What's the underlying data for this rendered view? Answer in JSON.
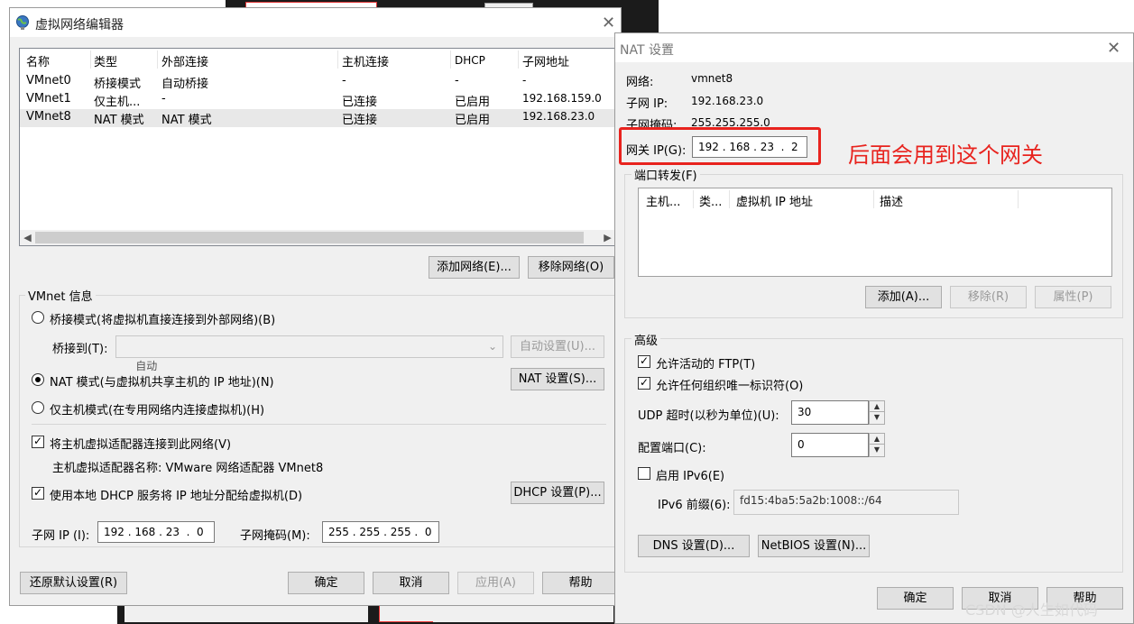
{
  "vne": {
    "title": "虚拟网络编辑器",
    "columns": [
      "名称",
      "类型",
      "外部连接",
      "主机连接",
      "DHCP",
      "子网地址"
    ],
    "rows": [
      {
        "name": "VMnet0",
        "type": "桥接模式",
        "ext": "自动桥接",
        "host": "-",
        "dhcp": "-",
        "subnet": "-"
      },
      {
        "name": "VMnet1",
        "type": "仅主机...",
        "ext": "-",
        "host": "已连接",
        "dhcp": "已启用",
        "subnet": "192.168.159.0"
      },
      {
        "name": "VMnet8",
        "type": "NAT 模式",
        "ext": "NAT 模式",
        "host": "已连接",
        "dhcp": "已启用",
        "subnet": "192.168.23.0"
      }
    ],
    "add_network": "添加网络(E)...",
    "remove_network": "移除网络(O)",
    "vmnet_info": "VMnet 信息",
    "bridge_mode": "桥接模式(将虚拟机直接连接到外部网络)(B)",
    "bridge_to": "桥接到(T):",
    "bridge_value": "自动",
    "auto_settings": "自动设置(U)...",
    "nat_mode": "NAT 模式(与虚拟机共享主机的 IP 地址)(N)",
    "nat_settings": "NAT 设置(S)...",
    "host_only": "仅主机模式(在专用网络内连接虚拟机)(H)",
    "connect_adapter": "将主机虚拟适配器连接到此网络(V)",
    "adapter_name": "主机虚拟适配器名称: VMware 网络适配器 VMnet8",
    "use_dhcp": "使用本地 DHCP 服务将 IP 地址分配给虚拟机(D)",
    "dhcp_settings": "DHCP 设置(P)...",
    "subnet_ip_label": "子网 IP (I):",
    "subnet_ip": "192 . 168 . 23  .  0",
    "subnet_mask_label": "子网掩码(M):",
    "subnet_mask": "255 . 255 . 255 .  0",
    "restore_defaults": "还原默认设置(R)",
    "ok": "确定",
    "cancel": "取消",
    "apply": "应用(A)",
    "help": "帮助"
  },
  "nat": {
    "title": "NAT 设置",
    "network_label": "网络:",
    "network_value": "vmnet8",
    "subnet_ip_label": "子网 IP:",
    "subnet_ip_value": "192.168.23.0",
    "subnet_mask_label": "子网掩码:",
    "subnet_mask_value": "255.255.255.0",
    "gateway_label": "网关 IP(G):",
    "gateway_value": "192 . 168 . 23  .  2",
    "port_forwarding": "端口转发(F)",
    "pf_columns": [
      "主机...",
      "类...",
      "虚拟机 IP 地址",
      "描述"
    ],
    "add": "添加(A)...",
    "remove": "移除(R)",
    "properties": "属性(P)",
    "advanced": "高级",
    "allow_ftp": "允许活动的 FTP(T)",
    "allow_oui": "允许任何组织唯一标识符(O)",
    "udp_timeout_label": "UDP 超时(以秒为单位)(U):",
    "udp_timeout_value": "30",
    "config_port_label": "配置端口(C):",
    "config_port_value": "0",
    "enable_ipv6": "启用 IPv6(E)",
    "ipv6_prefix_label": "IPv6 前缀(6):",
    "ipv6_prefix_value": "fd15:4ba5:5a2b:1008::/64",
    "dns_settings": "DNS 设置(D)...",
    "netbios_settings": "NetBIOS 设置(N)...",
    "ok": "确定",
    "cancel": "取消",
    "help": "帮助"
  },
  "annotation": "后面会用到这个网关",
  "watermark": "CSDN @人生如代码",
  "colors": {
    "annotation": "#e8231e"
  }
}
